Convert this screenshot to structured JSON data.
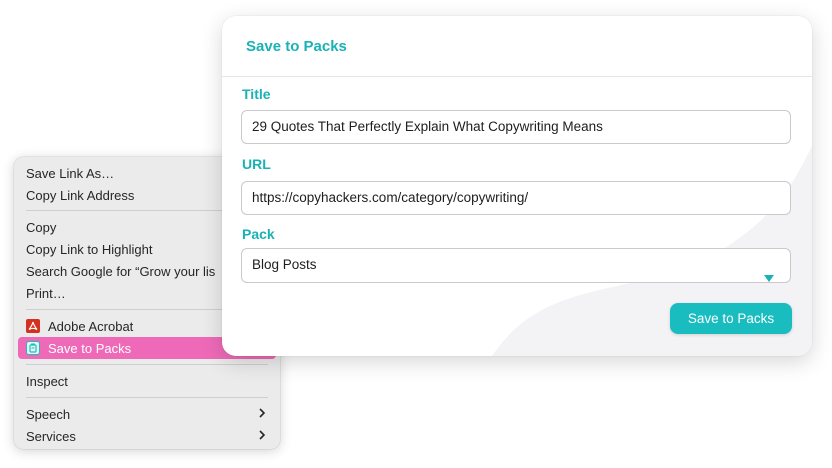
{
  "context_menu": {
    "items": [
      {
        "label": "Save Link As…"
      },
      {
        "label": "Copy Link Address"
      },
      {
        "label": "Copy"
      },
      {
        "label": "Copy Link to Highlight"
      },
      {
        "label": "Search Google for “Grow your lis"
      },
      {
        "label": "Print…"
      },
      {
        "label": "Adobe Acrobat",
        "icon": "adobe-acrobat-icon"
      },
      {
        "label": "Save to Packs",
        "icon": "packs-icon",
        "highlighted": true
      },
      {
        "label": "Inspect"
      },
      {
        "label": "Speech",
        "submenu": true
      },
      {
        "label": "Services",
        "submenu": true
      }
    ],
    "highlight_color": "#ee6ab8"
  },
  "dialog": {
    "title": "Save to Packs",
    "fields": {
      "title": {
        "label": "Title",
        "value": "29 Quotes That Perfectly Explain What Copywriting Means"
      },
      "url": {
        "label": "URL",
        "value": "https://copyhackers.com/category/copywriting/"
      },
      "pack": {
        "label": "Pack",
        "value": "Blog Posts",
        "icon": "dropdown-triangle-icon"
      }
    },
    "save_button": "Save to Packs",
    "accent_color": "#1ab2b4"
  }
}
